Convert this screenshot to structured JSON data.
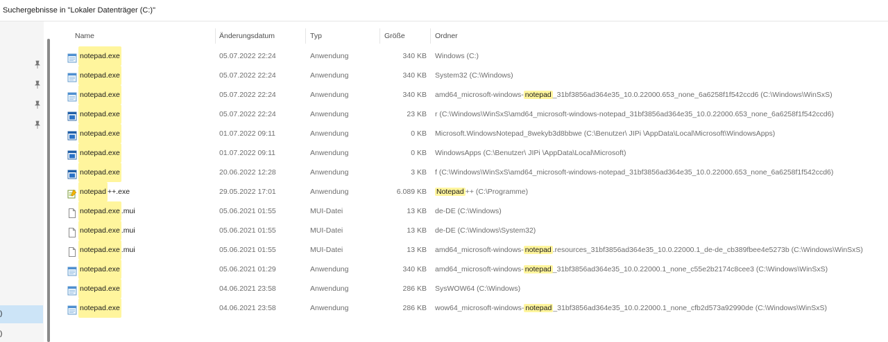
{
  "window": {
    "title": "Suchergebnisse in \"Lokaler Datenträger (C:)\""
  },
  "nav": {
    "item1": ")",
    "item2": ")"
  },
  "columns": {
    "name": "Name",
    "date": "Änderungsdatum",
    "type": "Typ",
    "size": "Größe",
    "folder": "Ordner"
  },
  "files": [
    {
      "icon": "app-window-icon",
      "name_hl": "notepad.exe",
      "name_rest": "",
      "date": "05.07.2022 22:24",
      "type": "Anwendung",
      "size": "340 KB",
      "folder_pre": "Windows (C:)",
      "folder_hl": "",
      "folder_post": ""
    },
    {
      "icon": "app-window-icon",
      "name_hl": "notepad.exe",
      "name_rest": "",
      "date": "05.07.2022 22:24",
      "type": "Anwendung",
      "size": "340 KB",
      "folder_pre": "System32 (C:\\Windows)",
      "folder_hl": "",
      "folder_post": ""
    },
    {
      "icon": "app-window-icon",
      "name_hl": "notepad.exe",
      "name_rest": "",
      "date": "05.07.2022 22:24",
      "type": "Anwendung",
      "size": "340 KB",
      "folder_pre": "amd64_microsoft-windows-",
      "folder_hl": "notepad",
      "folder_post": "_31bf3856ad364e35_10.0.22000.653_none_6a6258f1f542ccd6 (C:\\Windows\\WinSxS)"
    },
    {
      "icon": "app-blue-icon",
      "name_hl": "notepad.exe",
      "name_rest": "",
      "date": "05.07.2022 22:24",
      "type": "Anwendung",
      "size": "23 KB",
      "folder_pre": "r (C:\\Windows\\WinSxS\\amd64_microsoft-windows-notepad_31bf3856ad364e35_10.0.22000.653_none_6a6258f1f542ccd6)",
      "folder_hl": "",
      "folder_post": ""
    },
    {
      "icon": "app-blue-icon",
      "name_hl": "notepad.exe",
      "name_rest": "",
      "date": "01.07.2022 09:11",
      "type": "Anwendung",
      "size": "0 KB",
      "folder_pre": "Microsoft.WindowsNotepad_8wekyb3d8bbwe (C:\\Benutzer\\  JIPi  \\AppData\\Local\\Microsoft\\WindowsApps)",
      "folder_hl": "",
      "folder_post": ""
    },
    {
      "icon": "app-blue-icon",
      "name_hl": "notepad.exe",
      "name_rest": "",
      "date": "01.07.2022 09:11",
      "type": "Anwendung",
      "size": "0 KB",
      "folder_pre": "WindowsApps (C:\\Benutzer\\  JIPi  \\AppData\\Local\\Microsoft)",
      "folder_hl": "",
      "folder_post": ""
    },
    {
      "icon": "app-blue-icon",
      "name_hl": "notepad.exe",
      "name_rest": "",
      "date": "20.06.2022 12:28",
      "type": "Anwendung",
      "size": "3 KB",
      "folder_pre": "f (C:\\Windows\\WinSxS\\amd64_microsoft-windows-notepad_31bf3856ad364e35_10.0.22000.653_none_6a6258f1f542ccd6)",
      "folder_hl": "",
      "folder_post": ""
    },
    {
      "icon": "notepadpp-icon",
      "name_hl": "notepad",
      "name_rest": "++.exe",
      "date": "29.05.2022 17:01",
      "type": "Anwendung",
      "size": "6.089 KB",
      "folder_pre": "",
      "folder_hl": "Notepad",
      "folder_post": "++ (C:\\Programme)"
    },
    {
      "icon": "document-icon",
      "name_hl": "notepad.exe",
      "name_rest": ".mui",
      "date": "05.06.2021 01:55",
      "type": "MUI-Datei",
      "size": "13 KB",
      "folder_pre": "de-DE (C:\\Windows)",
      "folder_hl": "",
      "folder_post": ""
    },
    {
      "icon": "document-icon",
      "name_hl": "notepad.exe",
      "name_rest": ".mui",
      "date": "05.06.2021 01:55",
      "type": "MUI-Datei",
      "size": "13 KB",
      "folder_pre": "de-DE (C:\\Windows\\System32)",
      "folder_hl": "",
      "folder_post": ""
    },
    {
      "icon": "document-icon",
      "name_hl": "notepad.exe",
      "name_rest": ".mui",
      "date": "05.06.2021 01:55",
      "type": "MUI-Datei",
      "size": "13 KB",
      "folder_pre": "amd64_microsoft-windows-",
      "folder_hl": "notepad",
      "folder_post": ".resources_31bf3856ad364e35_10.0.22000.1_de-de_cb389fbee4e5273b (C:\\Windows\\WinSxS)"
    },
    {
      "icon": "app-window-icon",
      "name_hl": "notepad.exe",
      "name_rest": "",
      "date": "05.06.2021 01:29",
      "type": "Anwendung",
      "size": "340 KB",
      "folder_pre": "amd64_microsoft-windows-",
      "folder_hl": "notepad",
      "folder_post": "_31bf3856ad364e35_10.0.22000.1_none_c55e2b2174c8cee3 (C:\\Windows\\WinSxS)"
    },
    {
      "icon": "app-window-icon",
      "name_hl": "notepad.exe",
      "name_rest": "",
      "date": "04.06.2021 23:58",
      "type": "Anwendung",
      "size": "286 KB",
      "folder_pre": "SysWOW64 (C:\\Windows)",
      "folder_hl": "",
      "folder_post": ""
    },
    {
      "icon": "app-window-icon",
      "name_hl": "notepad.exe",
      "name_rest": "",
      "date": "04.06.2021 23:58",
      "type": "Anwendung",
      "size": "286 KB",
      "folder_pre": "wow64_microsoft-windows-",
      "folder_hl": "notepad",
      "folder_post": "_31bf3856ad364e35_10.0.22000.1_none_cfb2d573a92990de (C:\\Windows\\WinSxS)"
    }
  ]
}
